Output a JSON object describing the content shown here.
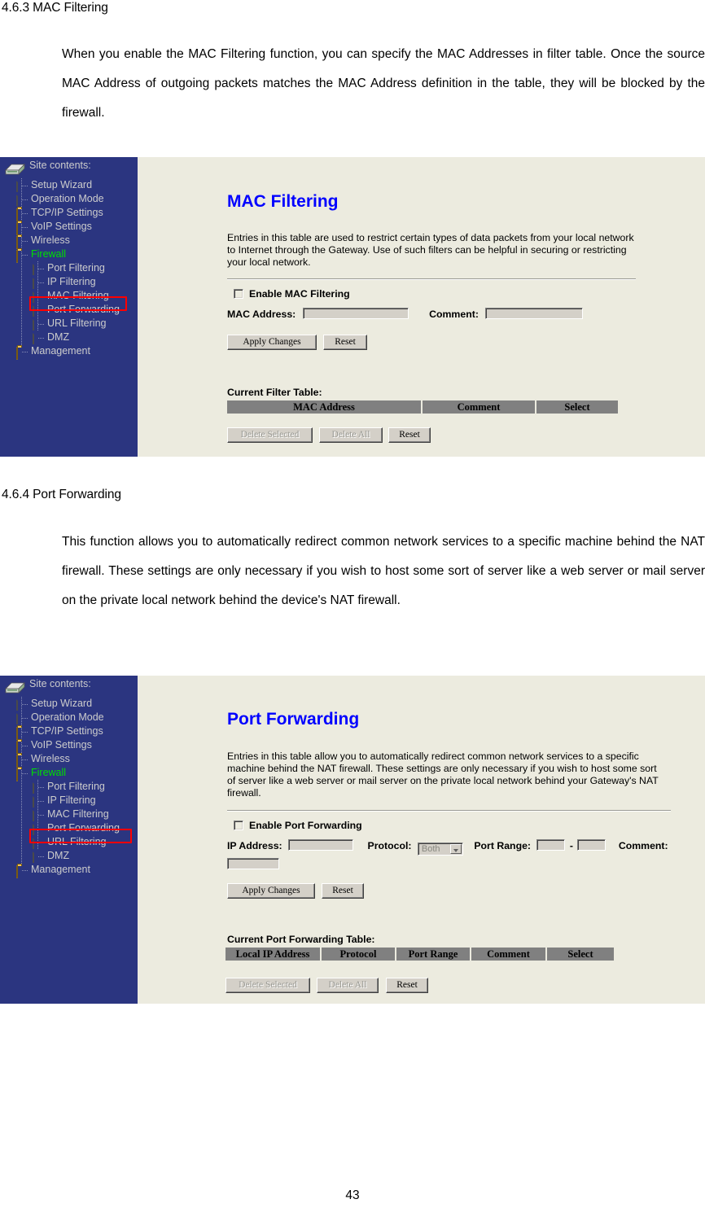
{
  "page": {
    "number": "43"
  },
  "sections": [
    {
      "heading": "4.6.3 MAC Filtering",
      "paragraph": "When you enable the MAC Filtering function, you can specify the MAC Addresses in filter table. Once the source MAC Address of outgoing packets matches the MAC Address definition in the table, they will be blocked by the firewall."
    },
    {
      "heading": "4.6.4 Port Forwarding",
      "paragraph": "This function allows you to automatically redirect common network services to a specific machine behind the NAT firewall. These settings are only necessary if you wish to host some sort of server like a web server or mail server on the private local network behind the device's NAT firewall."
    }
  ],
  "colors": {
    "sidebar_blue": "#2B3580",
    "content_bg": "#ECEBDF",
    "title_blue": "#0000FF",
    "firewall_green": "#00E000",
    "highlight_red": "#FF0000",
    "table_header_gray": "#808080"
  },
  "sidebar": {
    "title": "Site contents:",
    "items": [
      {
        "label": "Setup Wizard",
        "icon": "document-icon",
        "level": 1
      },
      {
        "label": "Operation Mode",
        "icon": "document-icon",
        "level": 1
      },
      {
        "label": "TCP/IP Settings",
        "icon": "folder-icon",
        "level": 1
      },
      {
        "label": "VoIP Settings",
        "icon": "folder-icon",
        "level": 1
      },
      {
        "label": "Wireless",
        "icon": "folder-icon",
        "level": 1
      },
      {
        "label": "Firewall",
        "icon": "folder-open-icon",
        "level": 1
      },
      {
        "label": "Port Filtering",
        "icon": "document-icon",
        "level": 2
      },
      {
        "label": "IP Filtering",
        "icon": "document-icon",
        "level": 2
      },
      {
        "label": "MAC Filtering",
        "icon": "document-icon",
        "level": 2
      },
      {
        "label": "Port Forwarding",
        "icon": "document-icon",
        "level": 2
      },
      {
        "label": "URL Filtering",
        "icon": "document-icon",
        "level": 2
      },
      {
        "label": "DMZ",
        "icon": "document-icon",
        "level": 2
      },
      {
        "label": "Management",
        "icon": "folder-icon",
        "level": 1
      }
    ]
  },
  "screenshot_mac": {
    "highlighted_item": "MAC Filtering",
    "title": "MAC Filtering",
    "description": "Entries in this table are used to restrict certain types of data packets from your local network to Internet through the Gateway. Use of such filters can be helpful in securing or restricting your local network.",
    "enable_label": "Enable MAC Filtering",
    "enable_checked": false,
    "mac_address_label": "MAC Address:",
    "mac_address_value": "",
    "comment_label": "Comment:",
    "comment_value": "",
    "apply_label": "Apply Changes",
    "reset_label": "Reset",
    "table_caption": "Current Filter Table:",
    "table_headers": [
      "MAC Address",
      "Comment",
      "Select"
    ],
    "table_rows": [],
    "delete_selected_label": "Delete Selected",
    "delete_all_label": "Delete All",
    "table_reset_label": "Reset"
  },
  "screenshot_pf": {
    "highlighted_item": "Port Forwarding",
    "title": "Port Forwarding",
    "description": "Entries in this table allow you to automatically redirect common network services to a specific machine behind the NAT firewall. These settings are only necessary if you wish to host some sort of server like a web server or mail server on the private local network behind your Gateway's NAT firewall.",
    "enable_label": "Enable Port Forwarding",
    "enable_checked": false,
    "ip_address_label": "IP Address:",
    "ip_address_value": "",
    "protocol_label": "Protocol:",
    "protocol_value": "Both",
    "protocol_options": [
      "Both"
    ],
    "port_range_label": "Port Range:",
    "port_range_from": "",
    "port_range_separator": "-",
    "port_range_to": "",
    "comment_label": "Comment:",
    "comment_value": "",
    "apply_label": "Apply Changes",
    "reset_label": "Reset",
    "table_caption": "Current Port Forwarding Table:",
    "table_headers": [
      "Local IP Address",
      "Protocol",
      "Port Range",
      "Comment",
      "Select"
    ],
    "table_rows": [],
    "delete_selected_label": "Delete Selected",
    "delete_all_label": "Delete All",
    "table_reset_label": "Reset"
  }
}
